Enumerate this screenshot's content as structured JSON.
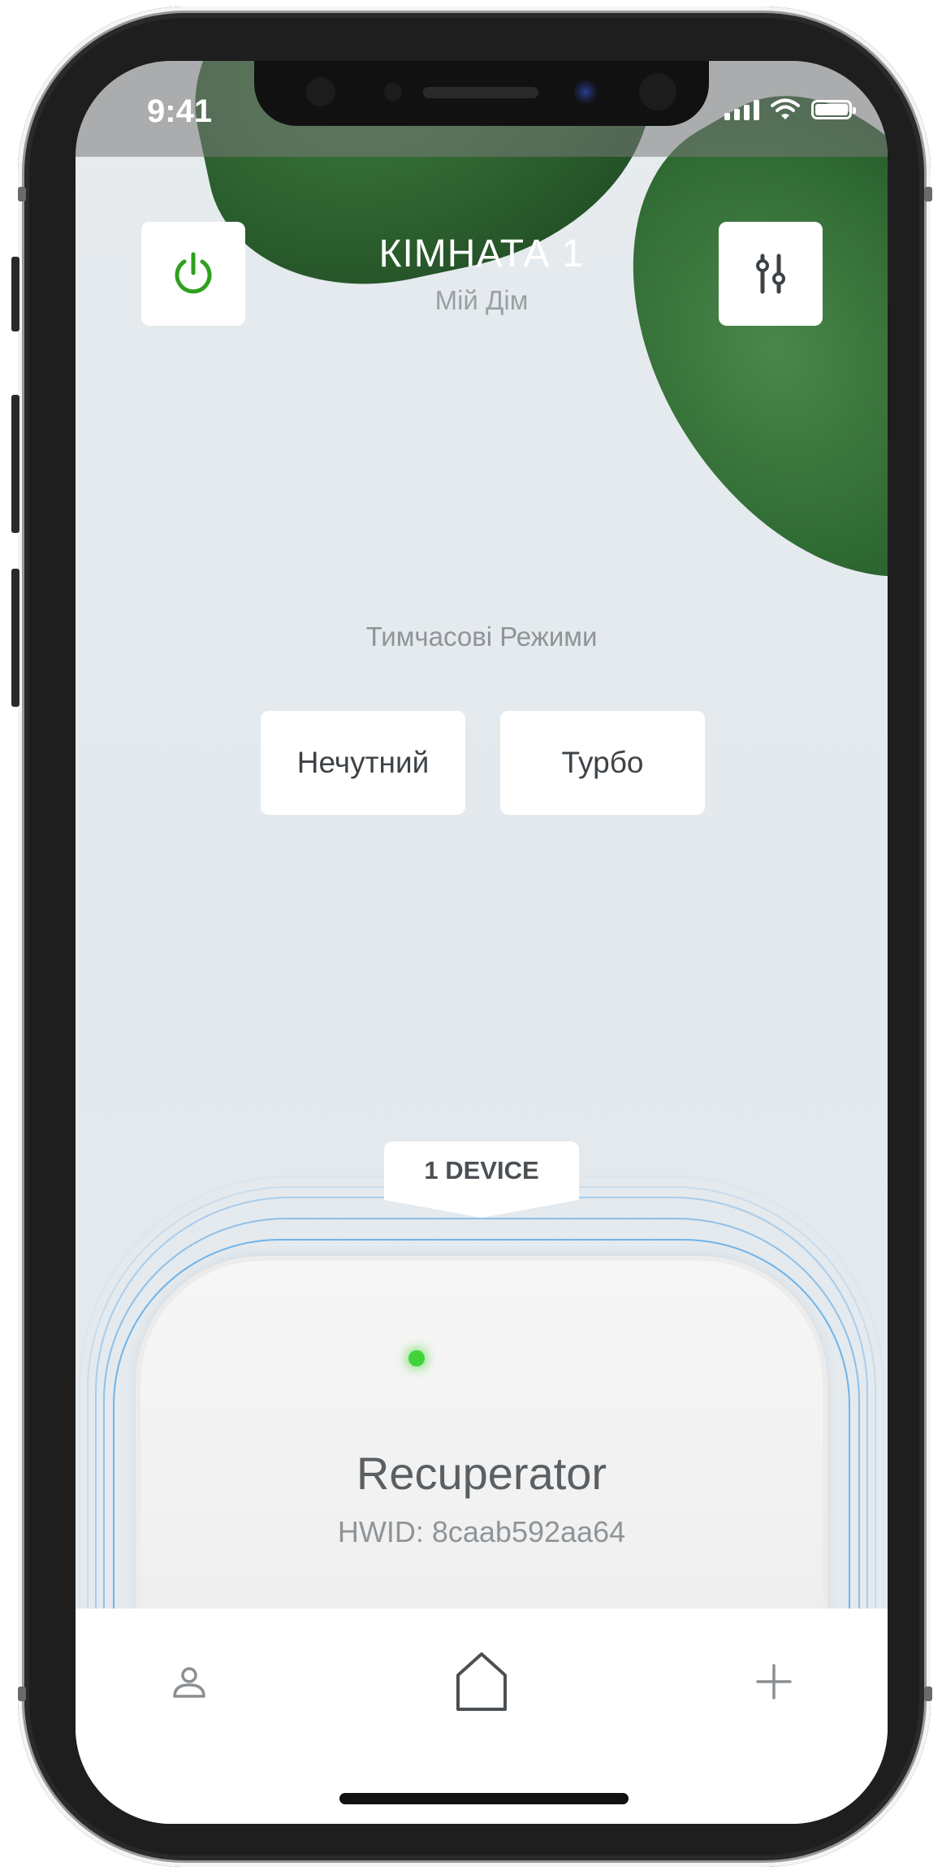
{
  "status_bar": {
    "time": "9:41",
    "signal_icon": "cellular-signal-icon",
    "wifi_icon": "wifi-icon",
    "battery_icon": "battery-icon"
  },
  "header": {
    "title": "КІМНАТА 1",
    "subtitle": "Мій Дім",
    "power_icon": "power-icon",
    "settings_icon": "sliders-icon"
  },
  "temporary_modes": {
    "label": "Тимчасові Режими",
    "buttons": [
      "Нечутний",
      "Турбо"
    ]
  },
  "devices": {
    "count_label": "1 DEVICE",
    "items": [
      {
        "name": "Recuperator",
        "hwid": "HWID: 8caab592aa64",
        "status_color": "#40d43a"
      }
    ]
  },
  "tab_bar": {
    "items": [
      {
        "icon": "profile-icon",
        "selected": false
      },
      {
        "icon": "home-icon",
        "selected": true
      },
      {
        "icon": "plus-icon",
        "selected": false
      }
    ]
  },
  "colors": {
    "accent_green": "#2ea01e",
    "ring_blue": "#6fb4ea",
    "text_dark": "#3d4246"
  }
}
